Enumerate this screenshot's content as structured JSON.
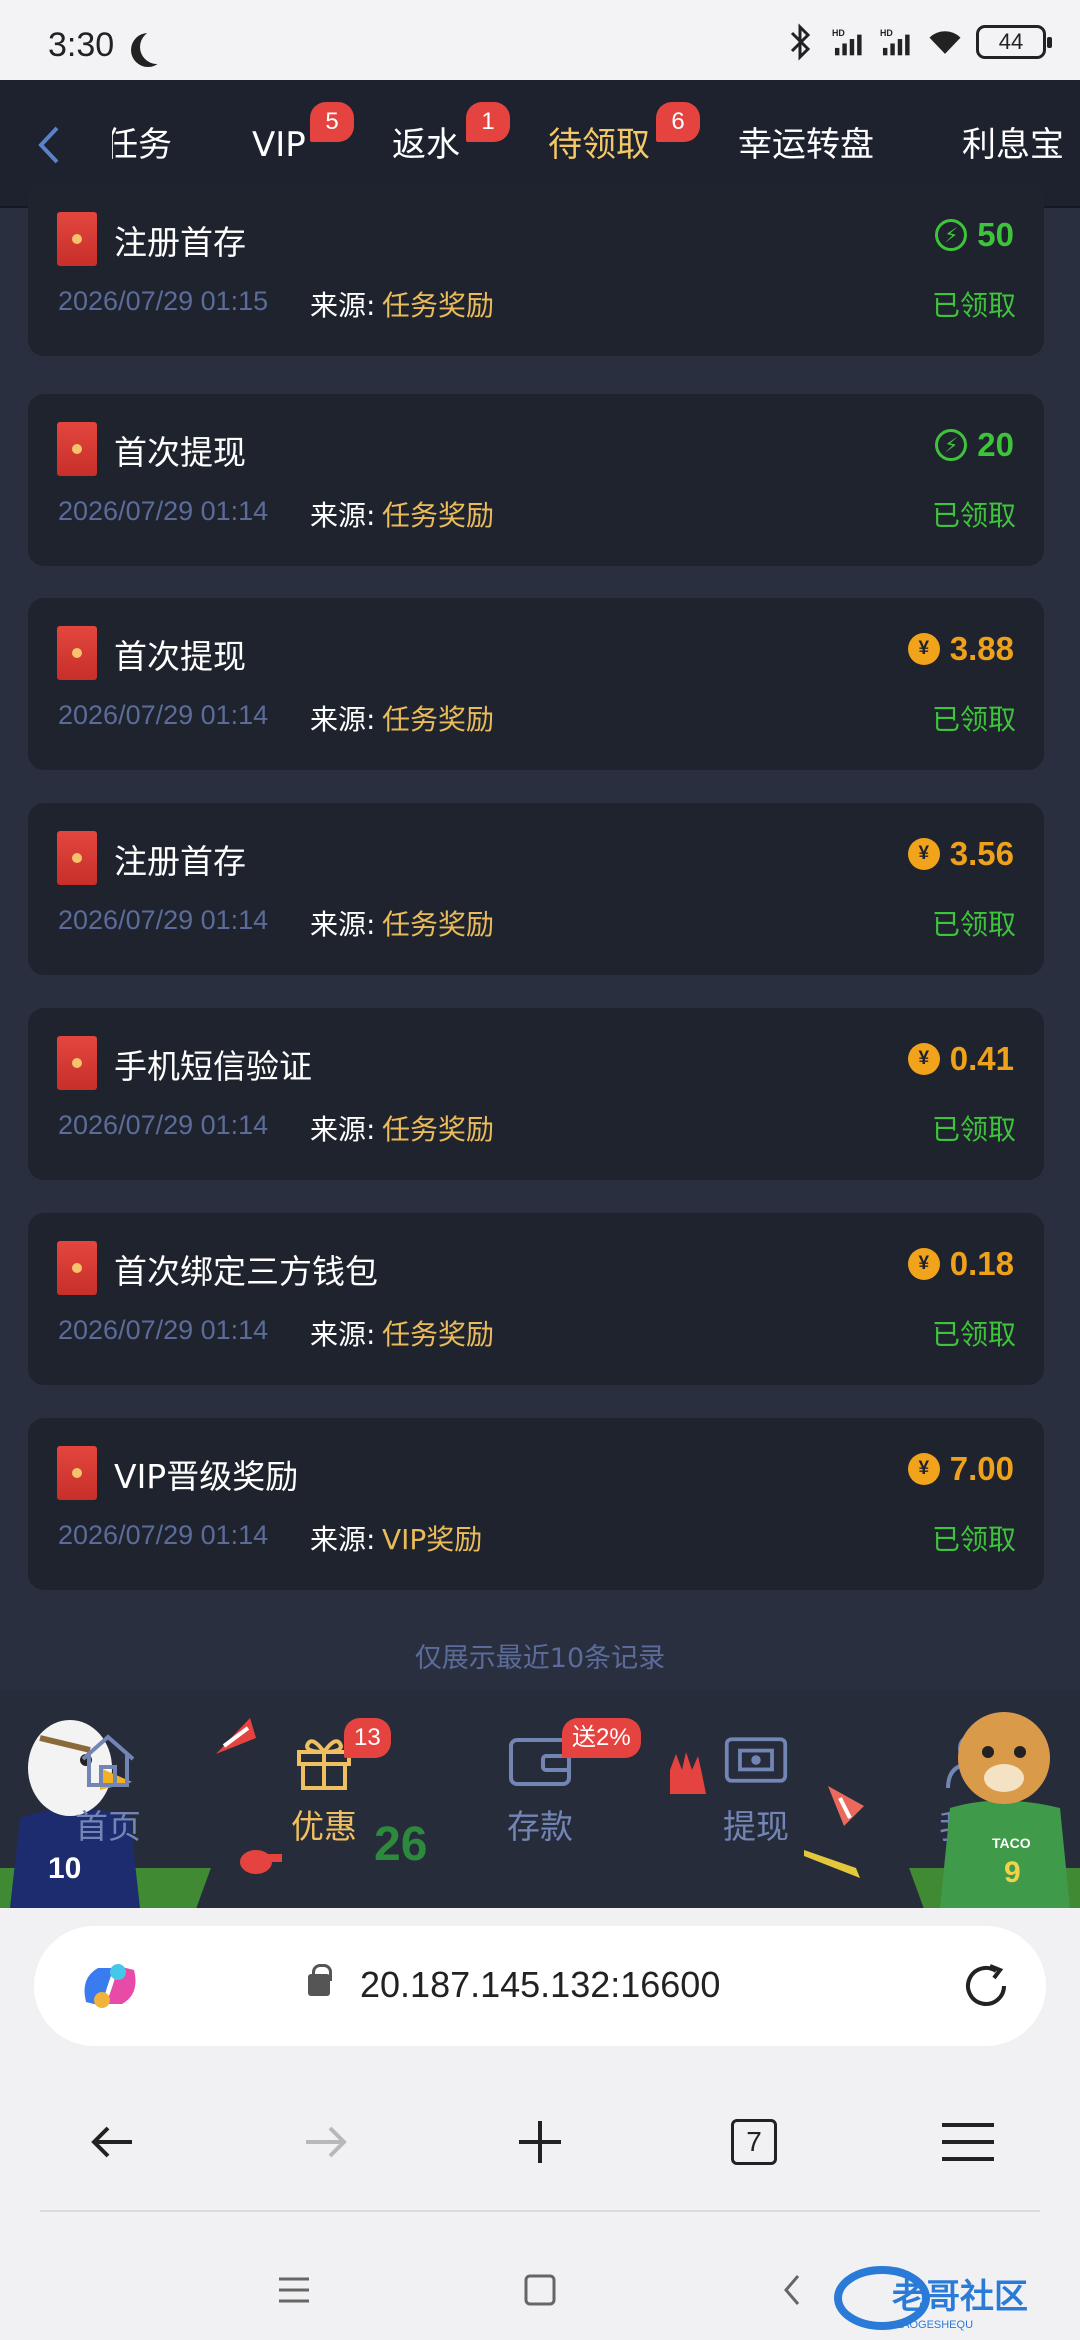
{
  "status_bar": {
    "time": "3:30",
    "battery": "44",
    "icons": [
      "moon-icon",
      "bluetooth-icon",
      "signal-hd-icon",
      "signal-hd-icon",
      "wifi-icon",
      "battery-icon"
    ]
  },
  "top_tabs": {
    "items": [
      {
        "label": "任务",
        "badge": null
      },
      {
        "label": "VIP",
        "badge": "5"
      },
      {
        "label": "返水",
        "badge": "1"
      },
      {
        "label": "待领取",
        "badge": "6",
        "active": true
      },
      {
        "label": "幸运转盘",
        "badge": null
      },
      {
        "label": "利息宝",
        "badge": null
      }
    ],
    "active_color": "#f3c866"
  },
  "records": [
    {
      "title": "注册首存",
      "time": "2026/07/29 01:15",
      "source_label": "来源:",
      "source": "任务奖励",
      "amount": "50",
      "amount_type": "bolt",
      "status": "已领取"
    },
    {
      "title": "首次提现",
      "time": "2026/07/29 01:14",
      "source_label": "来源:",
      "source": "任务奖励",
      "amount": "20",
      "amount_type": "bolt",
      "status": "已领取"
    },
    {
      "title": "首次提现",
      "time": "2026/07/29 01:14",
      "source_label": "来源:",
      "source": "任务奖励",
      "amount": "3.88",
      "amount_type": "coin",
      "status": "已领取"
    },
    {
      "title": "注册首存",
      "time": "2026/07/29 01:14",
      "source_label": "来源:",
      "source": "任务奖励",
      "amount": "3.56",
      "amount_type": "coin",
      "status": "已领取"
    },
    {
      "title": "手机短信验证",
      "time": "2026/07/29 01:14",
      "source_label": "来源:",
      "source": "任务奖励",
      "amount": "0.41",
      "amount_type": "coin",
      "status": "已领取"
    },
    {
      "title": "首次绑定三方钱包",
      "time": "2026/07/29 01:14",
      "source_label": "来源:",
      "source": "任务奖励",
      "amount": "0.18",
      "amount_type": "coin",
      "status": "已领取"
    },
    {
      "title": "VIP晋级奖励",
      "time": "2026/07/29 01:14",
      "source_label": "来源:",
      "source": "VIP奖励",
      "amount": "7.00",
      "amount_type": "coin",
      "status": "已领取"
    }
  ],
  "coin_symbol": "¥",
  "footer_note": "仅展示最近10条记录",
  "bottom_nav": {
    "items": [
      {
        "label": "首页",
        "icon": "home-icon"
      },
      {
        "label": "优惠",
        "icon": "gift-icon",
        "badge": "13",
        "active": true
      },
      {
        "label": "存款",
        "icon": "wallet-icon",
        "badge": "送2%"
      },
      {
        "label": "提现",
        "icon": "withdraw-icon"
      },
      {
        "label": "我的",
        "icon": "profile-icon"
      }
    ]
  },
  "browser": {
    "url": "20.187.145.132:16600",
    "tab_count": "7"
  },
  "colors": {
    "background": "#2a2f40",
    "card": "#1f232e",
    "green": "#3ec43a",
    "gold": "#f0a11a",
    "source": "#e9bb5a",
    "badge": "#e5433f"
  }
}
